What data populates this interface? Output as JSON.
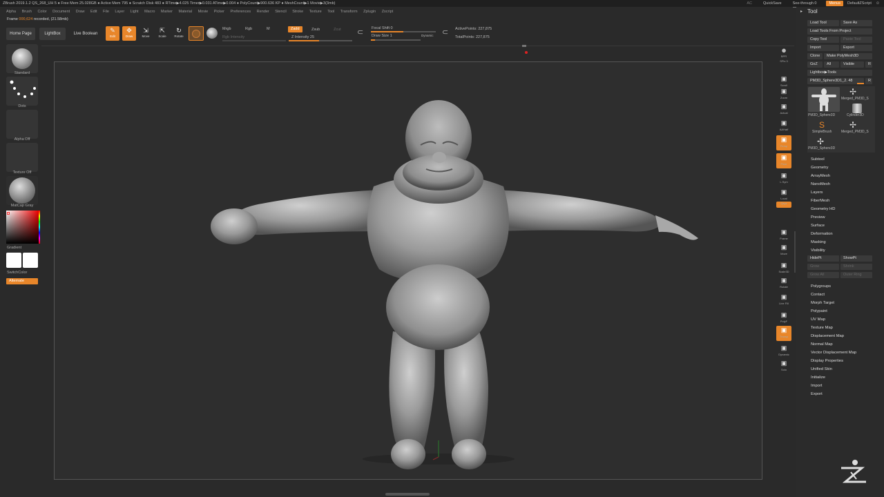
{
  "titlebar": {
    "text": "ZBrush 2019.1.2    QS_268_UH 5    ● Free Mem 25.028GB ● Active Mem 795 ● Scratch Disk 483 ● RTime▶4.025 Timer▶0.031 ATime▶0.004 ● PolyCount▶900.636 KP ● MeshCount▶1  Movie▶3(3mb)",
    "ac": "AC",
    "quicksave": "QuickSave",
    "see_through": "See-through   0",
    "menus": "Menus",
    "script": "DefaultZScript"
  },
  "menubar": [
    "Alpha",
    "Brush",
    "Color",
    "Document",
    "Draw",
    "Edit",
    "File",
    "Layer",
    "Light",
    "Macro",
    "Marker",
    "Material",
    "Movie",
    "Picker",
    "Preferences",
    "Render",
    "Stencil",
    "Stroke",
    "Texture",
    "Tool",
    "Transform",
    "Zplugin",
    "Zscript"
  ],
  "statusline": {
    "prefix": "Frame ",
    "frame": "000,624",
    "suffix": " recorded, (21.58mb)"
  },
  "toolbar": {
    "home_page": "Home Page",
    "lightbox": "LightBox",
    "live_boolean": "Live Boolean",
    "edit": "Edit",
    "draw": "Draw",
    "move": "Move",
    "scale": "Scale",
    "rotate": "Rotate",
    "mrgb": "Mrgb",
    "rgb": "Rgb",
    "m": "M",
    "rgb_intensity": "Rgb Intensity",
    "zadd": "Zadd",
    "zsub": "Zsub",
    "zcut": "Zcut",
    "z_intensity": "Z Intensity 25",
    "focal_shift": "Focal Shift 0",
    "draw_size": "Draw Size 1",
    "dynamic": "Dynamic",
    "active_points": "ActivePoints: 227,875",
    "total_points": "TotalPoints: 227,875"
  },
  "left_shelf": {
    "brush": "Standard",
    "stroke": "Dots",
    "alpha": "Alpha Off",
    "texture": "Texture Off",
    "material": "MatCap Gray",
    "gradient": "Gradient",
    "switch_color": "SwitchColor",
    "alternate": "Alternate"
  },
  "right_shelf": [
    {
      "label": "BPR",
      "icon": "render-icon"
    },
    {
      "label": "SPix 3",
      "icon": ""
    },
    {
      "label": "Scroll",
      "icon": "scroll-icon"
    },
    {
      "label": "Zoom",
      "icon": "zoom-icon"
    },
    {
      "label": "Actual",
      "icon": "actual-icon"
    },
    {
      "label": "AAHalf",
      "icon": "aahalf-icon"
    },
    {
      "label": "Persp",
      "icon": "persp-icon"
    },
    {
      "label": "Floor",
      "icon": "floor-icon"
    },
    {
      "label": "L.Sym",
      "icon": "lsym-icon"
    },
    {
      "label": "Local",
      "icon": "local-icon"
    },
    {
      "label": "Qxyz",
      "icon": ""
    },
    {
      "label": "Frame",
      "icon": "frame-icon"
    },
    {
      "label": "Move",
      "icon": "move-icon"
    },
    {
      "label": "Scale3D",
      "icon": "scale-icon"
    },
    {
      "label": "Rotate",
      "icon": "rotate-icon"
    },
    {
      "label": "Line Fill",
      "icon": "linefill-icon"
    },
    {
      "label": "PolyF",
      "icon": "polyf-icon"
    },
    {
      "label": "Transp",
      "icon": "transp-icon"
    },
    {
      "label": "Dynamic",
      "icon": "dynamic-icon"
    },
    {
      "label": "Solo",
      "icon": "solo-icon"
    },
    {
      "label": "Xpose",
      "icon": "xpose-icon"
    }
  ],
  "tool_panel": {
    "title": "Tool",
    "load_tool": "Load Tool",
    "save_as": "Save As",
    "load_from_project": "Load Tools From Project",
    "copy_tool": "Copy Tool",
    "paste_tool": "Paste Tool",
    "import": "Import",
    "export": "Export",
    "clone": "Clone",
    "make_polymesh": "Make PolyMesh3D",
    "goz": "GoZ",
    "all": "All",
    "visible": "Visible",
    "r": "R",
    "lightbox_tools": "Lightbox▶Tools",
    "current_tool": "PM3D_Sphere3D1_2. 48",
    "r2": "R",
    "thumbs": [
      "PM3D_Sphere3D",
      "Merged_PM3D_S",
      "SimpleBrush",
      "Cylinder3D",
      "Merged_PM3D_S",
      "PM3D_Sphere3D"
    ],
    "sections": [
      "Subtool",
      "Geometry",
      "ArrayMesh",
      "NanoMesh",
      "Layers",
      "FiberMesh",
      "Geometry HD",
      "Preview",
      "Surface",
      "Deformation",
      "Masking",
      "Visibility"
    ],
    "hide_pt": "HidePt",
    "show_pt": "ShowPt",
    "grow": "Grow",
    "shrink": "Shrink",
    "grow_all": "Grow All",
    "outer_ring": "Outer Ring",
    "sections2": [
      "Polygroups",
      "Contact",
      "Morph Target",
      "Polypaint",
      "UV Map",
      "Texture Map",
      "Displacement Map",
      "Normal Map",
      "Vector Displacement Map",
      "Display Properties",
      "Unified Skin",
      "Initialize",
      "Import",
      "Export"
    ]
  },
  "colors": {
    "accent": "#e8862a",
    "panel": "#2b2b2b",
    "viewport": "#2e2e2e"
  }
}
